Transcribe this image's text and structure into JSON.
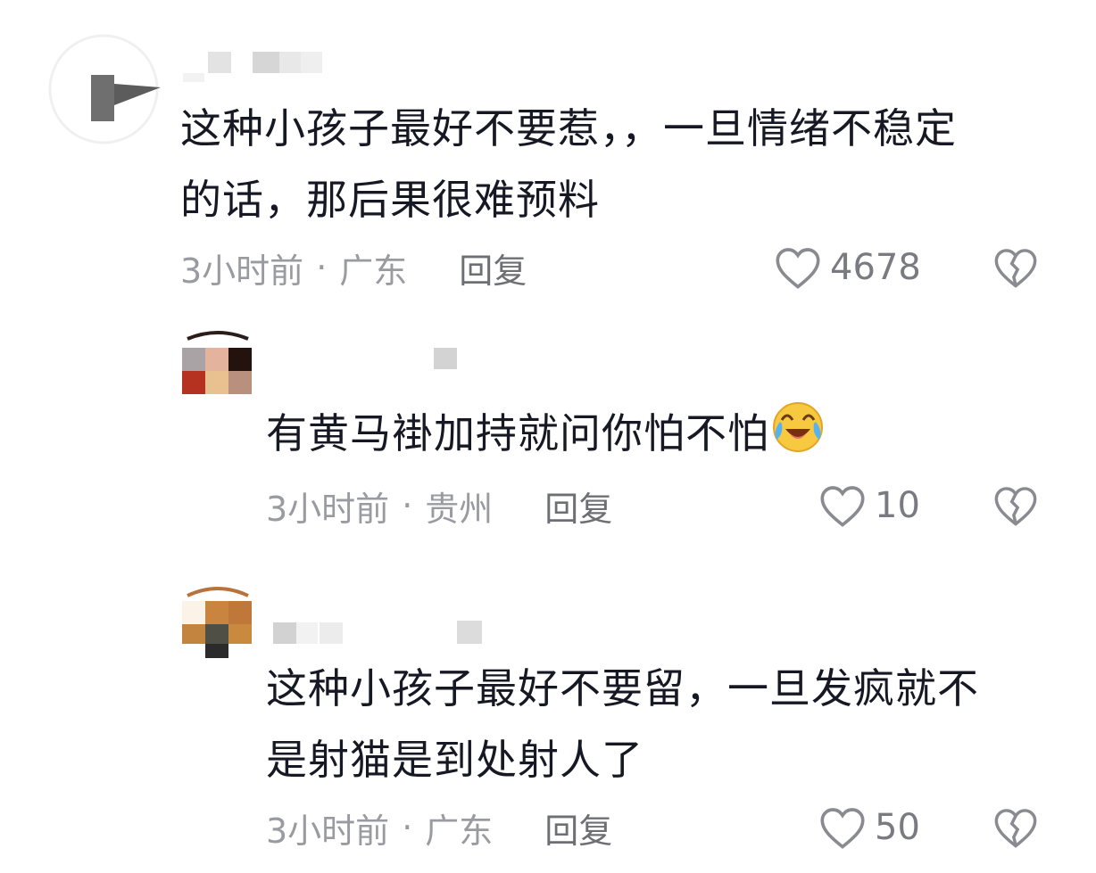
{
  "comments": [
    {
      "text": "这种小孩子最好不要惹，，一旦情绪不稳定的话，那后果很难预料",
      "line1": "这种小孩子最好不要惹，，一旦情绪不稳定",
      "line2": "的话，那后果很难预料",
      "time": "3小时前",
      "separator": "·",
      "location": "广东",
      "reply_label": "回复",
      "likes": "4678"
    },
    {
      "text": "有黄马褂加持就问你怕不怕",
      "line1": "有黄马褂加持就问你怕不怕",
      "emoji": "crying-laughing-emoji",
      "time": "3小时前",
      "separator": "·",
      "location": "贵州",
      "reply_label": "回复",
      "likes": "10"
    },
    {
      "text": "这种小孩子最好不要留，一旦发疯就不是射猫是到处射人了",
      "line1": "这种小孩子最好不要留，一旦发疯就不",
      "line2": "是射猫是到处射人了",
      "time": "3小时前",
      "separator": "·",
      "location": "广东",
      "reply_label": "回复",
      "likes": "50"
    }
  ],
  "icons": {
    "like": "heart-outline-icon",
    "dislike": "broken-heart-icon"
  },
  "colors": {
    "text": "#161823",
    "meta": "#9a9ba1",
    "reply": "#6e6f74"
  }
}
